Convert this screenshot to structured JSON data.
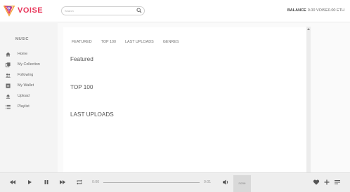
{
  "brand": {
    "name": "VOISE",
    "color": "#e8385c"
  },
  "search": {
    "placeholder": "Search"
  },
  "balance": {
    "label": "BALANCE",
    "value": "0.00 VOISE",
    "eth": "0.00 ETH"
  },
  "sidebar": {
    "heading": "MUSIC",
    "items": [
      {
        "label": "Home",
        "icon": "home-icon"
      },
      {
        "label": "My Collection",
        "icon": "collection-icon"
      },
      {
        "label": "Following",
        "icon": "following-icon"
      },
      {
        "label": "My Wallet",
        "icon": "wallet-icon"
      },
      {
        "label": "Upload",
        "icon": "upload-icon"
      },
      {
        "label": "Playlist",
        "icon": "playlist-icon"
      }
    ]
  },
  "main": {
    "tabs": [
      "FEATURED",
      "TOP 100",
      "LAST UPLOADS",
      "GENRES"
    ],
    "sections": [
      "Featured",
      "TOP 100",
      "LAST UPLOADS"
    ]
  },
  "player": {
    "time_current": "0:00",
    "time_total": "0:01",
    "volume_label": "none",
    "progress": 0
  }
}
